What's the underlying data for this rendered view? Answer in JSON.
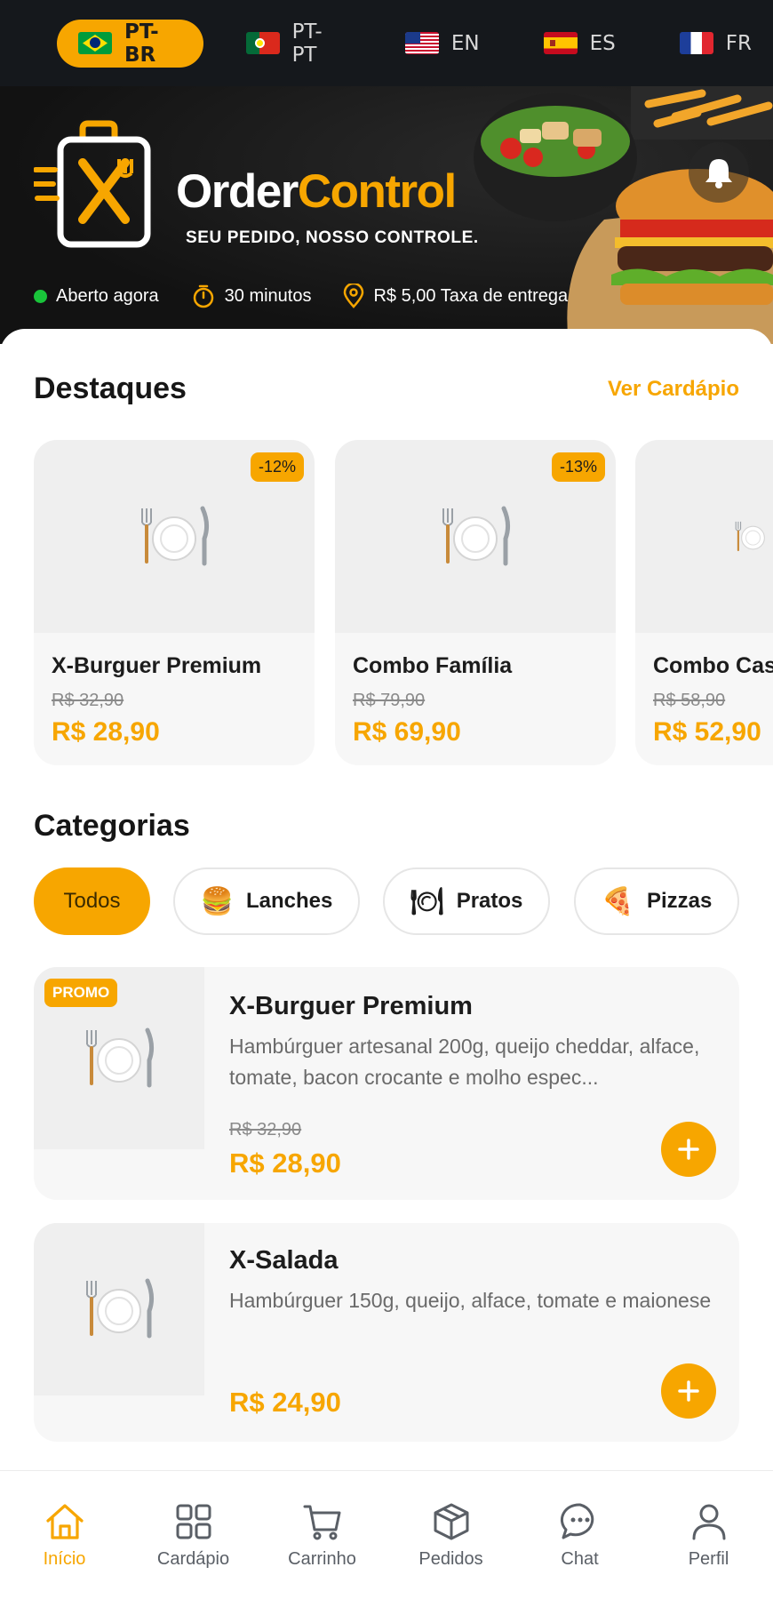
{
  "languages": [
    {
      "code": "PT-BR",
      "flag": "brazil-flag"
    },
    {
      "code": "PT-PT",
      "flag": "portugal-flag"
    },
    {
      "code": "EN",
      "flag": "usa-flag"
    },
    {
      "code": "ES",
      "flag": "spain-flag"
    },
    {
      "code": "FR",
      "flag": "france-flag"
    }
  ],
  "active_language": "PT-BR",
  "brand": {
    "name_part1": "Order",
    "name_part2": "Control",
    "tagline": "SEU PEDIDO, NOSSO CONTROLE."
  },
  "status": {
    "open": "Aberto agora",
    "time": "30 minutos",
    "fee": "R$ 5,00 Taxa de entrega"
  },
  "featured": {
    "title": "Destaques",
    "link": "Ver Cardápio",
    "items": [
      {
        "name": "X-Burguer Premium",
        "old_price": "R$ 32,90",
        "price": "R$ 28,90",
        "discount": "-12%"
      },
      {
        "name": "Combo Família",
        "old_price": "R$ 79,90",
        "price": "R$ 69,90",
        "discount": "-13%"
      },
      {
        "name": "Combo Casal",
        "old_price": "R$ 58,90",
        "price": "R$ 52,90",
        "discount": ""
      }
    ]
  },
  "categories": {
    "title": "Categorias",
    "items": [
      {
        "label": "Todos",
        "emoji": ""
      },
      {
        "label": "Lanches",
        "emoji": "🍔"
      },
      {
        "label": "Pratos",
        "emoji": "🍽"
      },
      {
        "label": "Pizzas",
        "emoji": "🍕"
      }
    ]
  },
  "products": [
    {
      "badge": "PROMO",
      "name": "X-Burguer Premium",
      "description": "Hambúrguer artesanal 200g, queijo cheddar, alface, tomate, bacon crocante e molho espec...",
      "old_price": "R$ 32,90",
      "price": "R$ 28,90"
    },
    {
      "badge": "",
      "name": "X-Salada",
      "description": "Hambúrguer 150g, queijo, alface, tomate e maionese",
      "old_price": "",
      "price": "R$ 24,90"
    }
  ],
  "nav": {
    "items": [
      {
        "label": "Início",
        "icon": "home-icon"
      },
      {
        "label": "Cardápio",
        "icon": "grid-icon"
      },
      {
        "label": "Carrinho",
        "icon": "cart-icon"
      },
      {
        "label": "Pedidos",
        "icon": "box-icon"
      },
      {
        "label": "Chat",
        "icon": "chat-icon"
      },
      {
        "label": "Perfil",
        "icon": "user-icon"
      }
    ],
    "active": "Início"
  },
  "colors": {
    "accent": "#f7a600",
    "dark": "#15181c",
    "online": "#19c43a"
  }
}
